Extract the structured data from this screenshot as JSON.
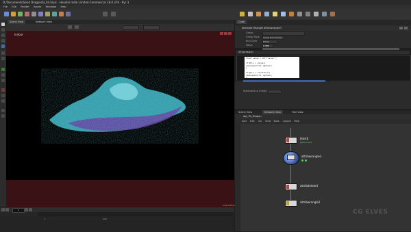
{
  "window": {
    "title": "D:/Documents/Sand Dragon/SI_04.hiplc - Houdini Indie Limited-Commercial 18.0.378 - Pyr 3"
  },
  "menu": [
    "File",
    "Edit",
    "Render",
    "Assets",
    "Windows",
    "Help"
  ],
  "viewport": {
    "camera_label": "Indoor",
    "corner_info": "Indie Edition"
  },
  "timeline": {
    "frame": "1",
    "start": "1",
    "end": "240"
  },
  "params": {
    "node_title": "Attribute Wrangle  attribwrangle3",
    "tabs": [
      "Code",
      "Bindings"
    ],
    "rows": [
      {
        "label": "Group",
        "value": ""
      },
      {
        "label": "Group Type",
        "value": "Guess from Group"
      },
      {
        "label": "Run Over",
        "value": "Points"
      },
      {
        "label": "Value",
        "value": "0.786"
      }
    ],
    "vex_label": "VEXpression",
    "code_lines": [
      "float value = chf(\"value\");",
      "",
      "if(@P.y > value){",
      "    removepoint(0, @ptnum);",
      "}",
      "",
      "if(@P.y < value*0.5){",
      "    removepoint(0, @ptnum);",
      "}"
    ],
    "attrib_label": "Attributes to Create"
  },
  "network": {
    "tabs": [
      "Scene View",
      "Network View",
      "Tree View"
    ],
    "path": "obj  /  SI_Dragon",
    "menu": [
      "Add",
      "Edit",
      "Go",
      "View",
      "Tools",
      "Layout",
      "Help"
    ],
    "nodes": [
      {
        "name": "blast6",
        "sub": "@Cd.x<0.5"
      },
      {
        "name": "attribwrangle3",
        "sub": ""
      },
      {
        "name": "attribdelete4",
        "sub": ""
      },
      {
        "name": "attribwrangle2",
        "sub": ""
      }
    ]
  },
  "watermark": "CG ELVES",
  "colors": {
    "letterbox": "#3a1215",
    "cloud_primary": "#3fb8c8",
    "cloud_secondary": "#6a3aa0"
  }
}
